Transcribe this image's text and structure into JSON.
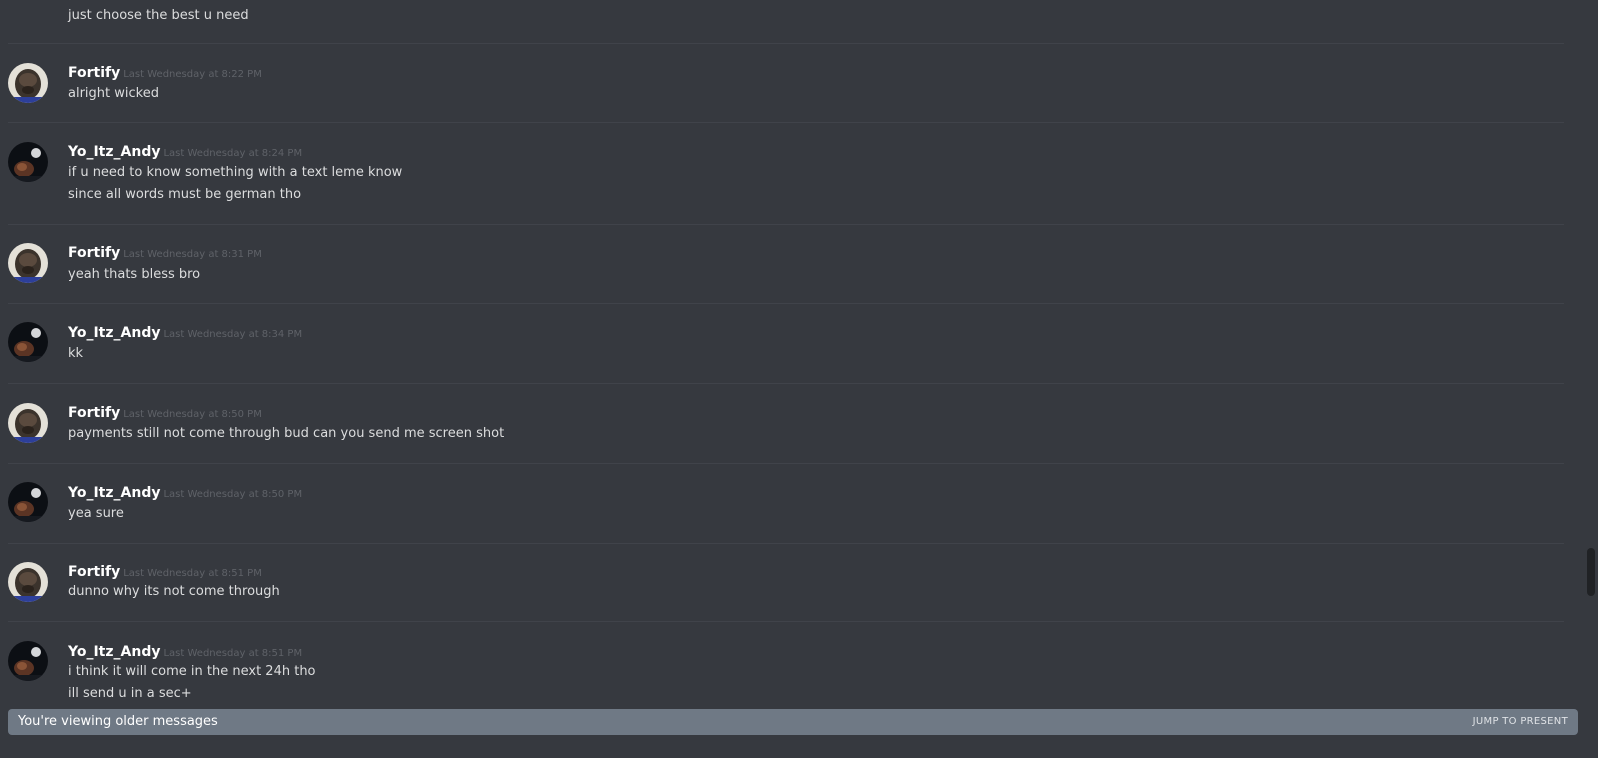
{
  "chat": {
    "top_text": "just choose the best u need",
    "messages": [
      {
        "author": "Fortify",
        "timestamp": "Last Wednesday at 8:22 PM",
        "lines": [
          "alright wicked"
        ]
      },
      {
        "author": "Yo_Itz_Andy",
        "timestamp": "Last Wednesday at 8:24 PM",
        "lines": [
          "if u need to know something with a text leme know",
          "since all words must be german tho"
        ]
      },
      {
        "author": "Fortify",
        "timestamp": "Last Wednesday at 8:31 PM",
        "lines": [
          "yeah thats bless bro"
        ]
      },
      {
        "author": "Yo_Itz_Andy",
        "timestamp": "Last Wednesday at 8:34 PM",
        "lines": [
          "kk"
        ]
      },
      {
        "author": "Fortify",
        "timestamp": "Last Wednesday at 8:50 PM",
        "lines": [
          "payments still not come through bud can you send me screen shot"
        ]
      },
      {
        "author": "Yo_Itz_Andy",
        "timestamp": "Last Wednesday at 8:50 PM",
        "lines": [
          "yea sure"
        ]
      },
      {
        "author": "Fortify",
        "timestamp": "Last Wednesday at 8:51 PM",
        "lines": [
          "dunno why its not come through"
        ]
      },
      {
        "author": "Yo_Itz_Andy",
        "timestamp": "Last Wednesday at 8:51 PM",
        "lines": [
          "i think it will come in the next 24h tho",
          "ill send u in a sec+"
        ]
      }
    ]
  },
  "older_bar": {
    "label": "You're viewing older messages",
    "jump_label": "JUMP TO PRESENT"
  },
  "colors": {
    "background": "#36393f",
    "older_bar": "#6f7985",
    "username": "#ffffff",
    "timestamp": "#5f6268"
  }
}
